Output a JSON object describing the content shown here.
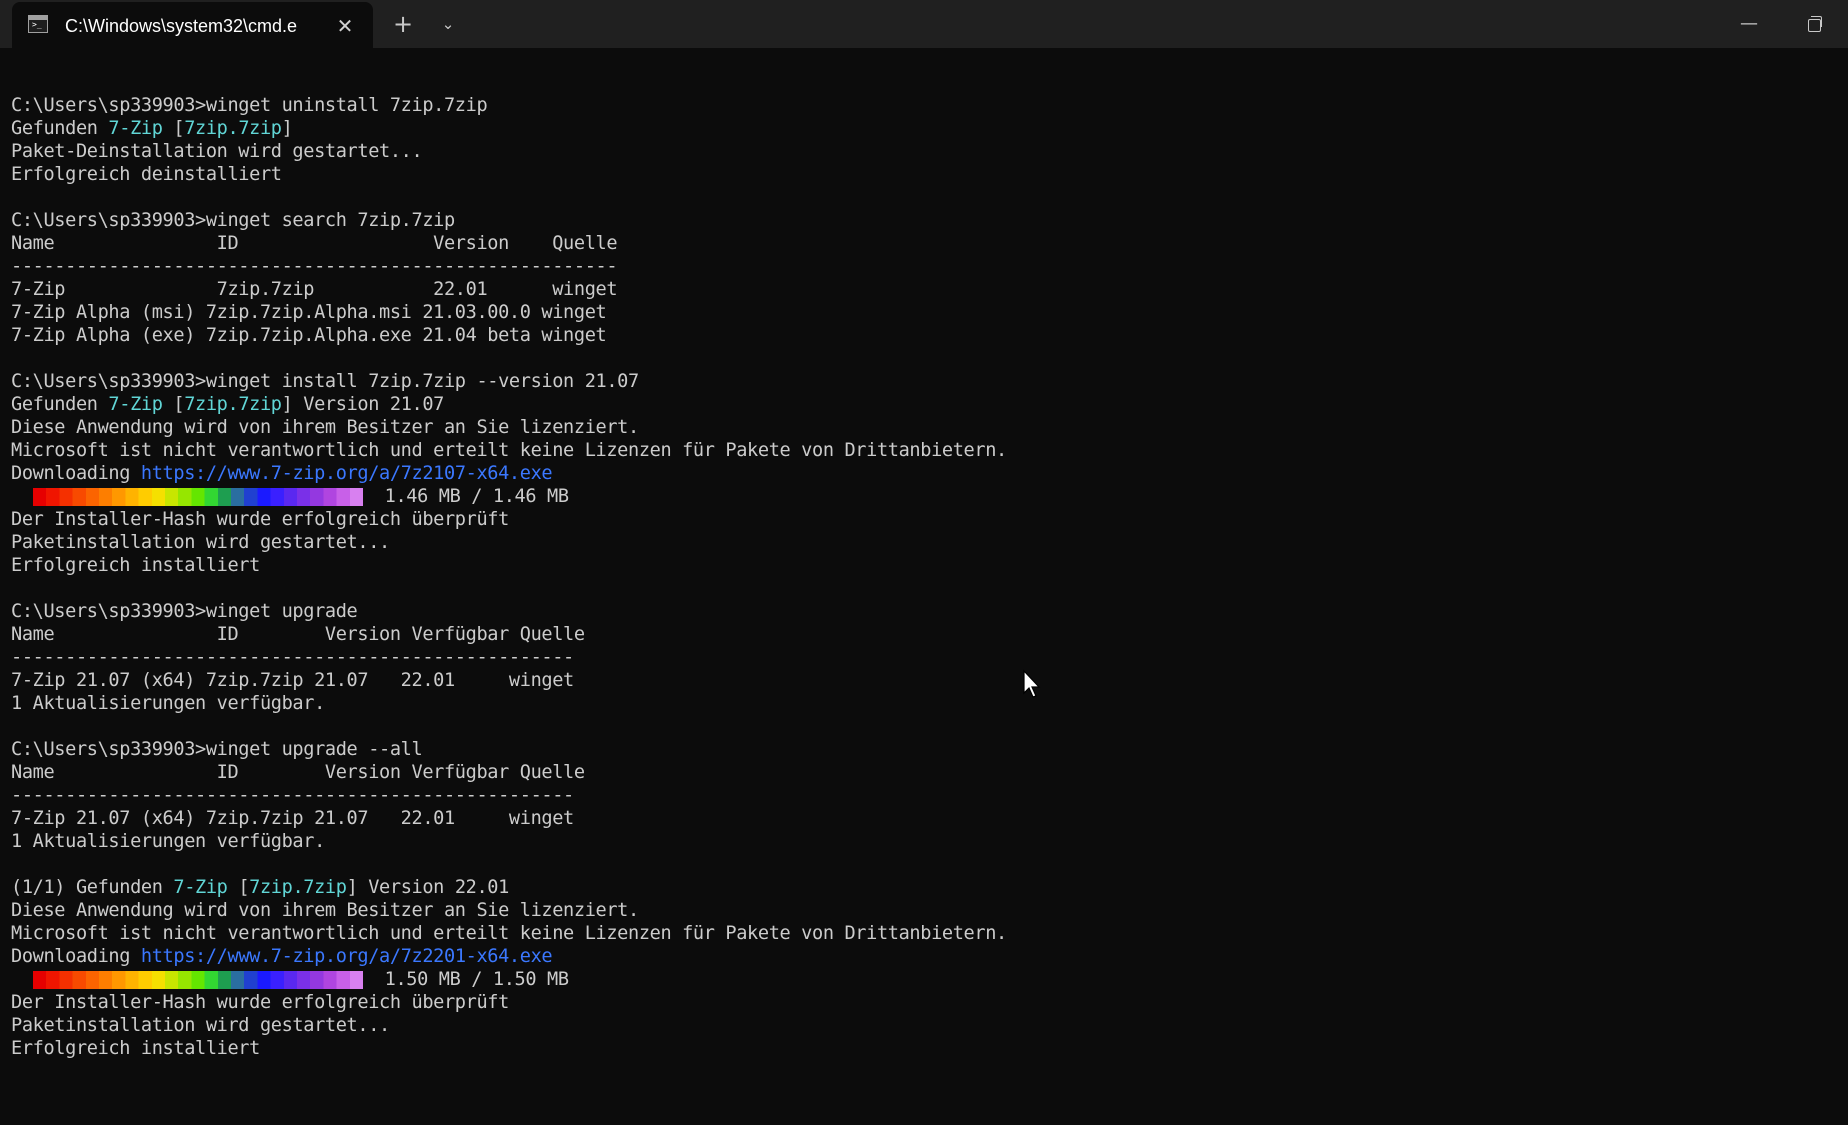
{
  "window": {
    "tab_title": "C:\\Windows\\system32\\cmd.e",
    "tab_icon": "cmd-icon",
    "close_tab": "✕",
    "new_tab": "+",
    "dropdown": "⌄",
    "minimize": "—"
  },
  "colors": {
    "background": "#0c0c0c",
    "text": "#cccccc",
    "accent_cyan": "#61d6d6",
    "link": "#3b78ff",
    "titlebar": "#202020"
  },
  "progress": [
    {
      "label": "1.46 MB / 1.46 MB",
      "fraction": 1.0
    },
    {
      "label": "1.50 MB / 1.50 MB",
      "fraction": 1.0
    }
  ],
  "lines": [
    [
      {
        "t": ""
      }
    ],
    [
      {
        "t": "C:\\Users\\sp339903>winget uninstall 7zip.7zip"
      }
    ],
    [
      {
        "t": "Gefunden "
      },
      {
        "t": "7-Zip",
        "c": "cyan"
      },
      {
        "t": " ["
      },
      {
        "t": "7zip.7zip",
        "c": "cyan"
      },
      {
        "t": "]"
      }
    ],
    [
      {
        "t": "Paket-Deinstallation wird gestartet..."
      }
    ],
    [
      {
        "t": "Erfolgreich deinstalliert"
      }
    ],
    [
      {
        "t": ""
      }
    ],
    [
      {
        "t": "C:\\Users\\sp339903>winget search 7zip.7zip"
      }
    ],
    [
      {
        "t": "Name               ID                  Version    Quelle"
      }
    ],
    [
      {
        "t": "--------------------------------------------------------"
      }
    ],
    [
      {
        "t": "7-Zip              7zip.7zip           22.01      winget"
      }
    ],
    [
      {
        "t": "7-Zip Alpha (msi) 7zip.7zip.Alpha.msi 21.03.00.0 winget"
      }
    ],
    [
      {
        "t": "7-Zip Alpha (exe) 7zip.7zip.Alpha.exe 21.04 beta winget"
      }
    ],
    [
      {
        "t": ""
      }
    ],
    [
      {
        "t": "C:\\Users\\sp339903>winget install 7zip.7zip --version 21.07"
      }
    ],
    [
      {
        "t": "Gefunden "
      },
      {
        "t": "7-Zip",
        "c": "cyan"
      },
      {
        "t": " ["
      },
      {
        "t": "7zip.7zip",
        "c": "cyan"
      },
      {
        "t": "] Version 21.07"
      }
    ],
    [
      {
        "t": "Diese Anwendung wird von ihrem Besitzer an Sie lizenziert."
      }
    ],
    [
      {
        "t": "Microsoft ist nicht verantwortlich und erteilt keine Lizenzen für Pakete von Drittanbietern."
      }
    ],
    [
      {
        "t": "Downloading "
      },
      {
        "t": "https://www.7-zip.org/a/7z2107-x64.exe",
        "c": "link"
      }
    ],
    [
      {
        "bar": 0
      }
    ],
    [
      {
        "t": "Der Installer-Hash wurde erfolgreich überprüft"
      }
    ],
    [
      {
        "t": "Paketinstallation wird gestartet..."
      }
    ],
    [
      {
        "t": "Erfolgreich installiert"
      }
    ],
    [
      {
        "t": ""
      }
    ],
    [
      {
        "t": "C:\\Users\\sp339903>winget upgrade"
      }
    ],
    [
      {
        "t": "Name               ID        Version Verfügbar Quelle"
      }
    ],
    [
      {
        "t": "----------------------------------------------------"
      }
    ],
    [
      {
        "t": "7-Zip 21.07 (x64) 7zip.7zip 21.07   22.01     winget"
      }
    ],
    [
      {
        "t": "1 Aktualisierungen verfügbar."
      }
    ],
    [
      {
        "t": ""
      }
    ],
    [
      {
        "t": "C:\\Users\\sp339903>winget upgrade --all"
      }
    ],
    [
      {
        "t": "Name               ID        Version Verfügbar Quelle"
      }
    ],
    [
      {
        "t": "----------------------------------------------------"
      }
    ],
    [
      {
        "t": "7-Zip 21.07 (x64) 7zip.7zip 21.07   22.01     winget"
      }
    ],
    [
      {
        "t": "1 Aktualisierungen verfügbar."
      }
    ],
    [
      {
        "t": ""
      }
    ],
    [
      {
        "t": "(1/1) Gefunden "
      },
      {
        "t": "7-Zip",
        "c": "cyan"
      },
      {
        "t": " ["
      },
      {
        "t": "7zip.7zip",
        "c": "cyan"
      },
      {
        "t": "] Version 22.01"
      }
    ],
    [
      {
        "t": "Diese Anwendung wird von ihrem Besitzer an Sie lizenziert."
      }
    ],
    [
      {
        "t": "Microsoft ist nicht verantwortlich und erteilt keine Lizenzen für Pakete von Drittanbietern."
      }
    ],
    [
      {
        "t": "Downloading "
      },
      {
        "t": "https://www.7-zip.org/a/7z2201-x64.exe",
        "c": "link"
      }
    ],
    [
      {
        "bar": 1
      }
    ],
    [
      {
        "t": "Der Installer-Hash wurde erfolgreich überprüft"
      }
    ],
    [
      {
        "t": "Paketinstallation wird gestartet..."
      }
    ],
    [
      {
        "t": "Erfolgreich installiert"
      }
    ]
  ]
}
